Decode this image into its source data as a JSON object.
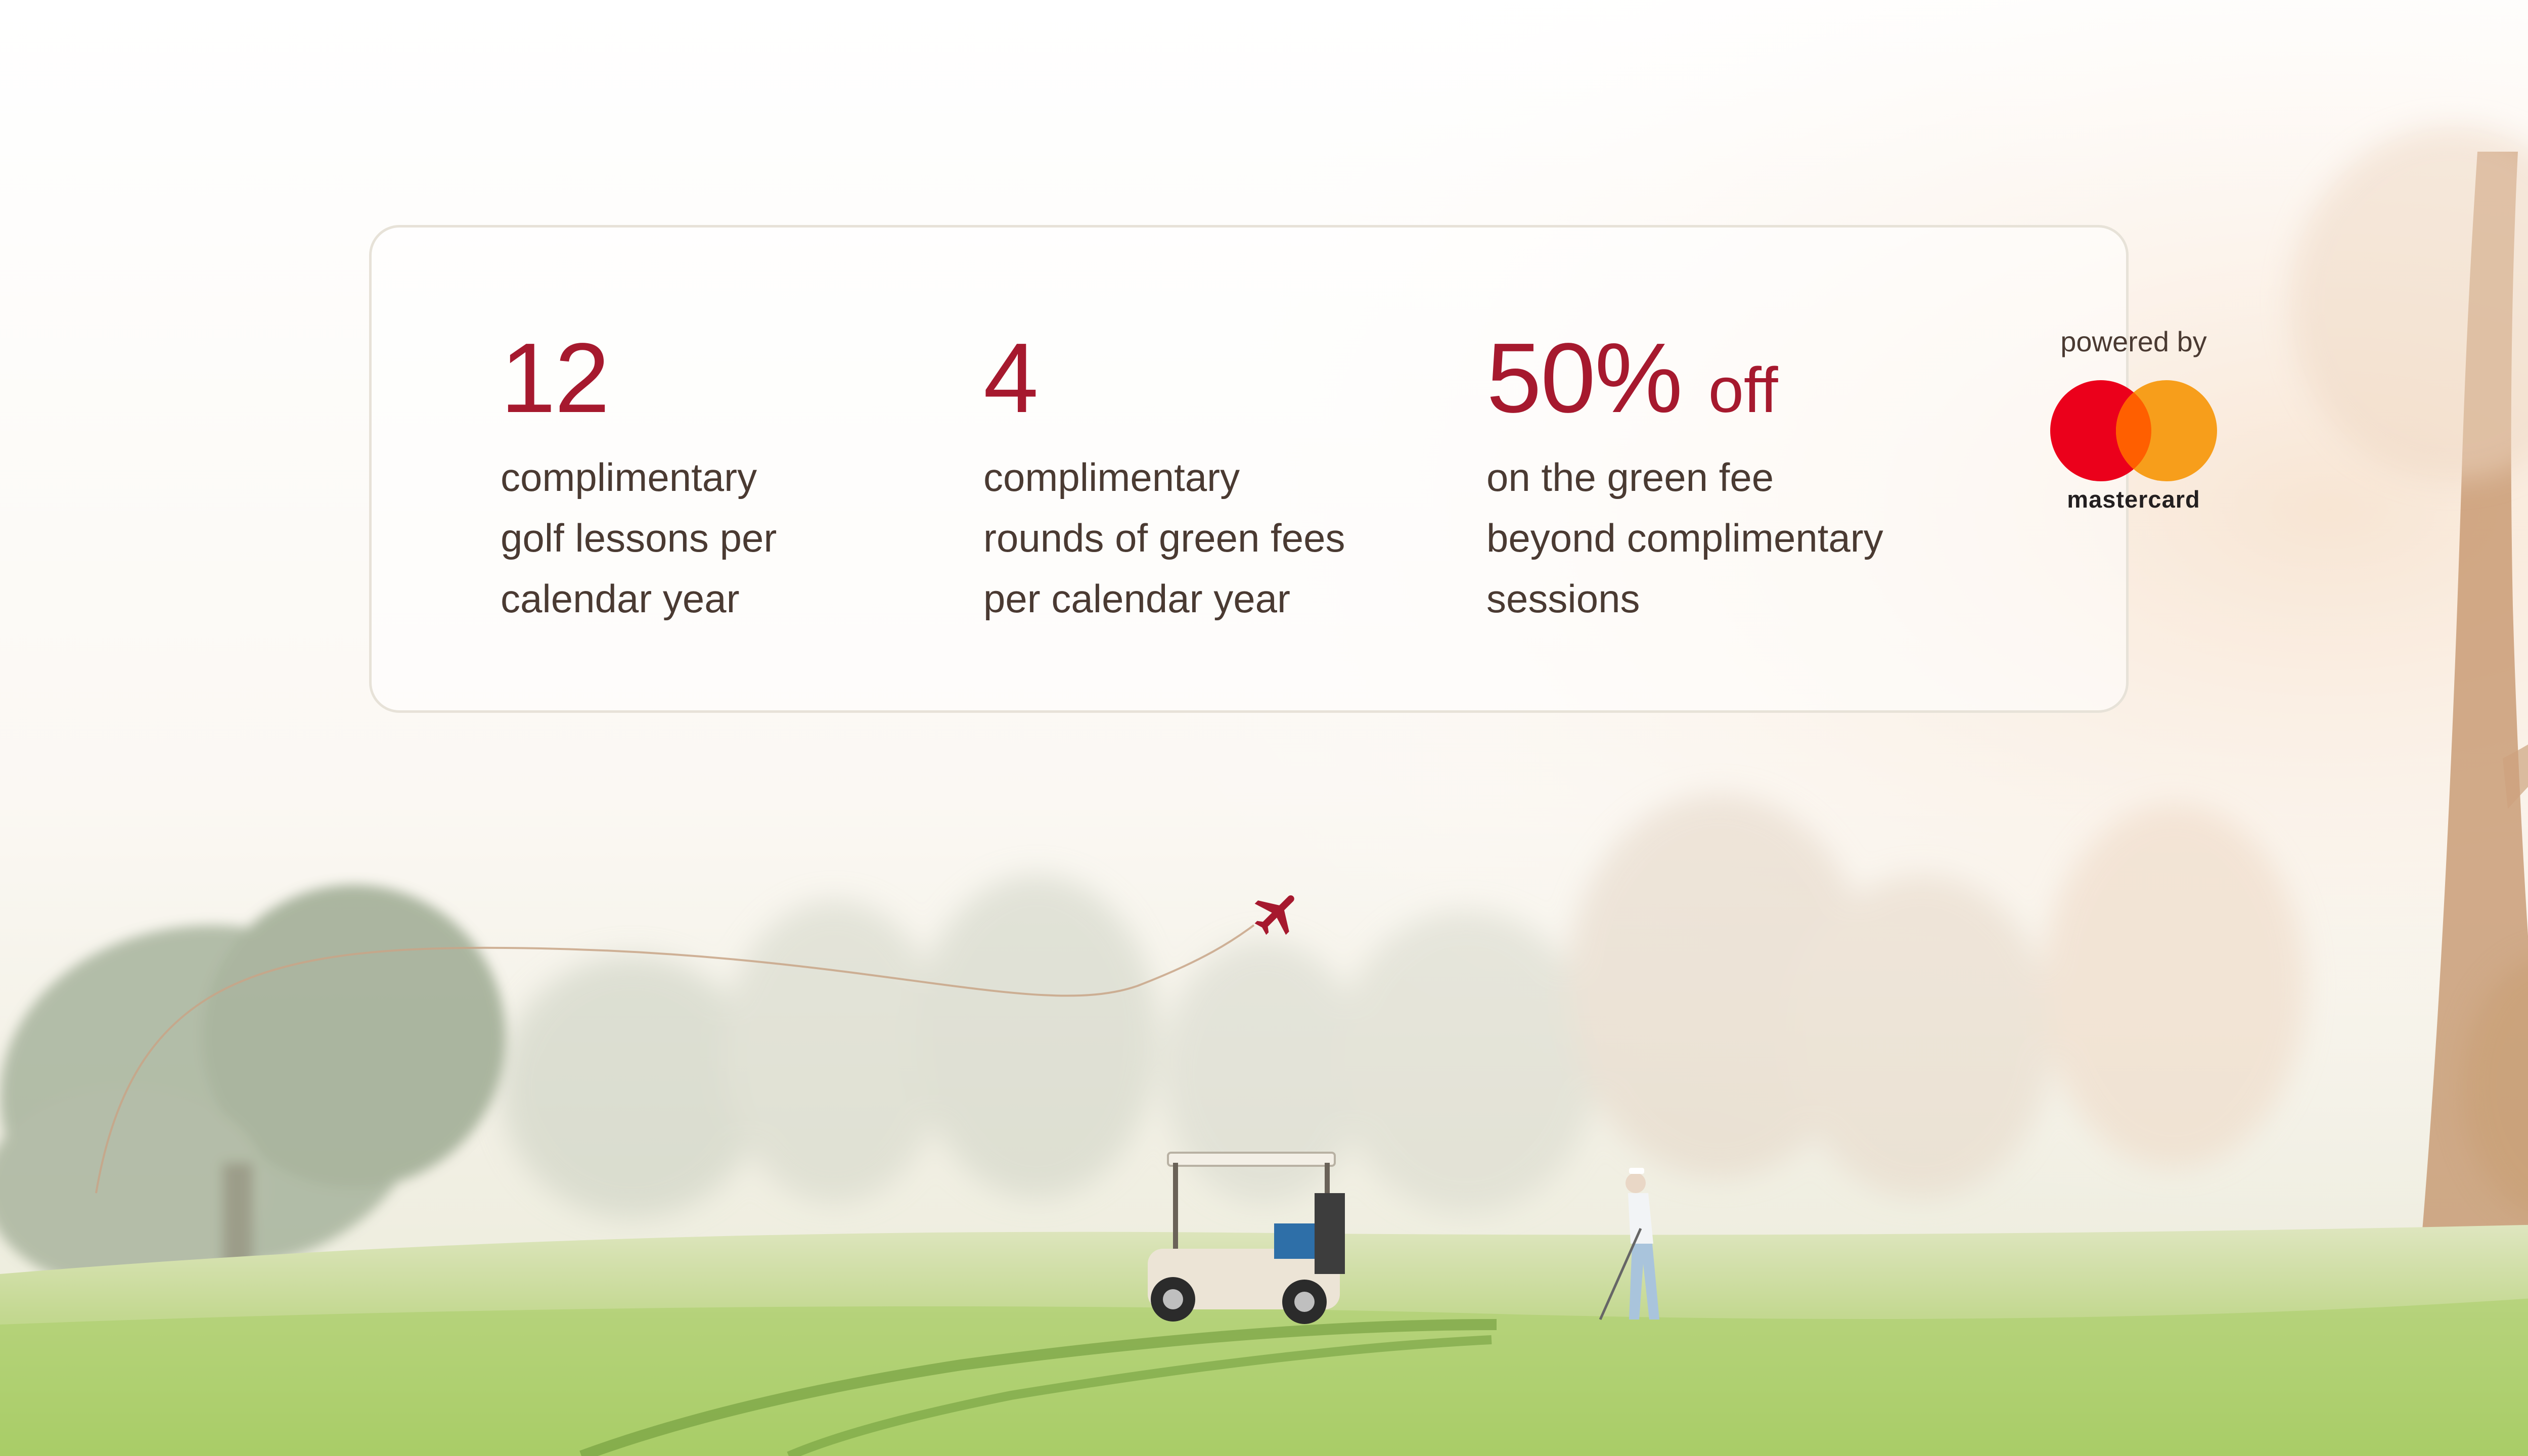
{
  "stats": [
    {
      "value": "12",
      "suffix": "",
      "lines": [
        "complimentary",
        "golf lessons per",
        "calendar year"
      ]
    },
    {
      "value": "4",
      "suffix": "",
      "lines": [
        "complimentary",
        "rounds of green fees",
        "per calendar year"
      ]
    },
    {
      "value": "50%",
      "suffix": "off",
      "lines": [
        "on the green fee",
        "beyond complimentary",
        "sessions"
      ]
    }
  ],
  "sponsor": {
    "label": "powered by",
    "wordmark": "mastercard",
    "icon": "mastercard-logo-icon"
  },
  "decor": {
    "plane_icon": "airplane-icon",
    "accent_color": "#a6192e",
    "text_color": "#4a3a32",
    "mc_red": "#eb001b",
    "mc_yellow": "#f79e1b",
    "mc_orange": "#ff5f00"
  }
}
